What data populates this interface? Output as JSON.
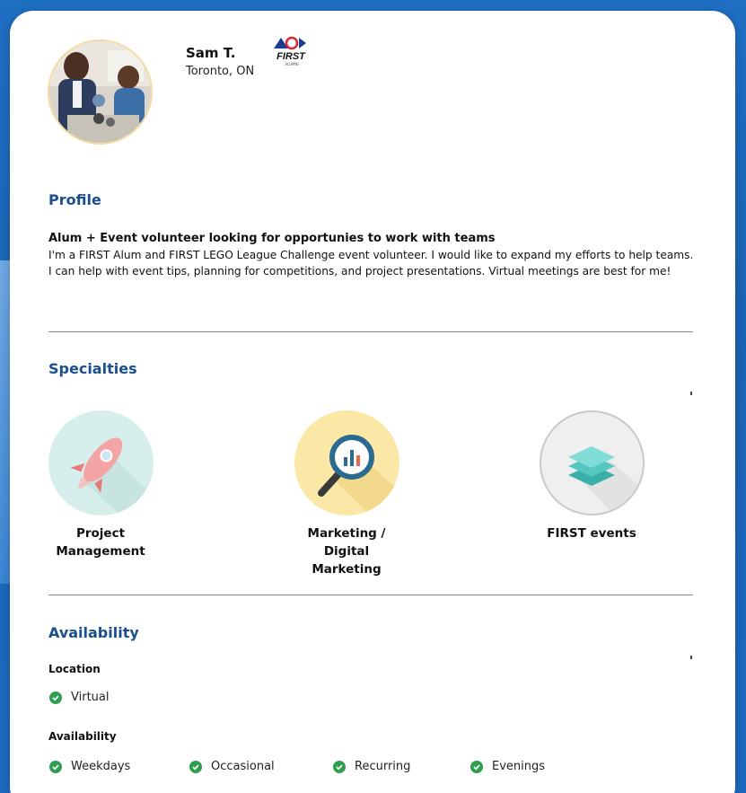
{
  "profile_header": {
    "name": "Sam T.",
    "location": "Toronto, ON",
    "logo_text": "FIRST",
    "logo_sub": "ALUMNI"
  },
  "profile": {
    "title": "Profile",
    "headline": "Alum + Event volunteer looking for opportunies to work with teams",
    "bio": "I'm a FIRST Alum and FIRST LEGO League Challenge event volunteer. I would like to expand my efforts to help teams. I can help with event tips, planning for competitions, and project presentations. Virtual meetings are best for me!"
  },
  "specialties": {
    "title": "Specialties",
    "items": [
      {
        "label": "Project Management",
        "icon": "rocket-icon",
        "color": "#d7efec"
      },
      {
        "label": "Marketing / Digital Marketing",
        "icon": "magnifier-chart-icon",
        "color": "#fbe7a6"
      },
      {
        "label": "FIRST events",
        "icon": "layers-icon",
        "color": "#efefef"
      }
    ]
  },
  "availability": {
    "title": "Availability",
    "location_title": "Location",
    "location_items": [
      "Virtual"
    ],
    "availability_title": "Availability",
    "availability_items": [
      "Weekdays",
      "Occasional",
      "Recurring",
      "Evenings"
    ]
  },
  "colors": {
    "accent": "#1a4e8c",
    "check": "#2e9e4f",
    "background": "#1f6fc2"
  }
}
